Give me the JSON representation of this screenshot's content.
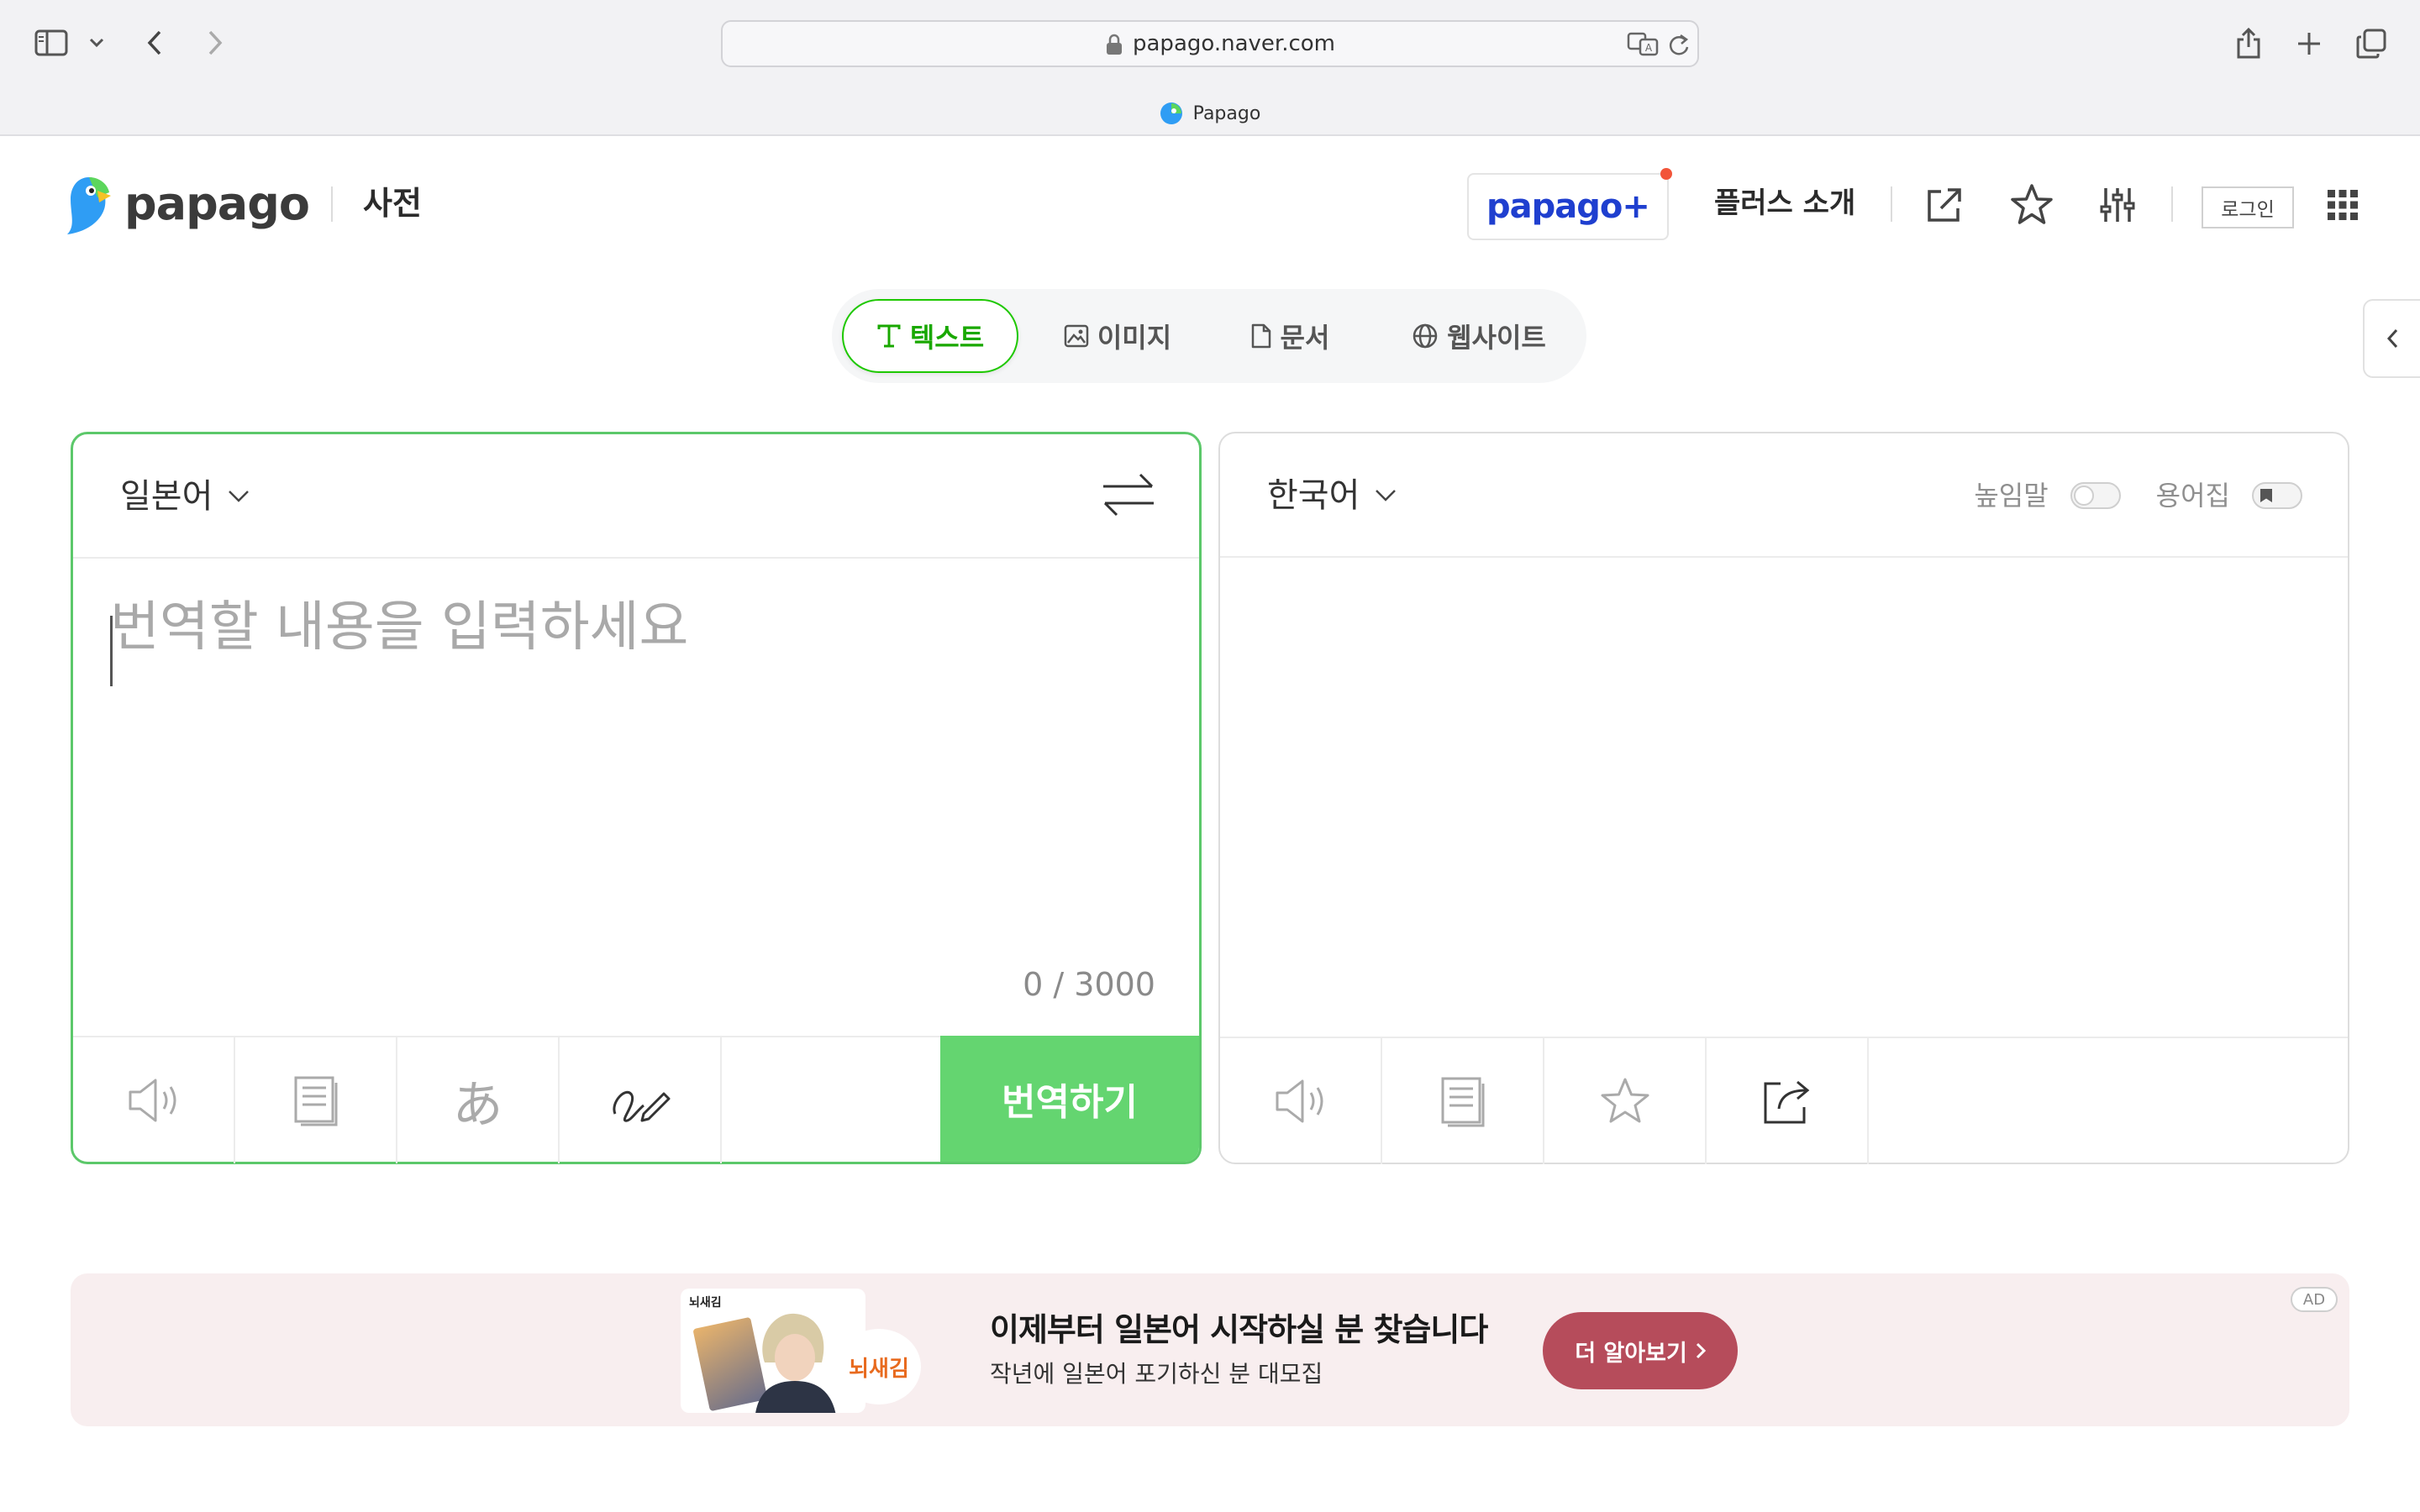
{
  "browser": {
    "url": "papago.naver.com",
    "tab_title": "Papago"
  },
  "header": {
    "logo_text": "papago",
    "dict_label": "사전",
    "plus_label": "papago+",
    "plus_intro_label": "플러스 소개",
    "login_label": "로그인"
  },
  "modes": {
    "items": [
      {
        "label": "텍스트",
        "icon": "text-icon",
        "active": true
      },
      {
        "label": "이미지",
        "icon": "image-icon",
        "active": false
      },
      {
        "label": "문서",
        "icon": "document-icon",
        "active": false
      },
      {
        "label": "웹사이트",
        "icon": "globe-icon",
        "active": false
      }
    ]
  },
  "source": {
    "language": "일본어",
    "placeholder": "번역할 내용을 입력하세요",
    "value": "",
    "counter": "0 / 3000",
    "tools": [
      "speaker-icon",
      "copy-icon",
      "hiragana-icon",
      "handwriting-icon"
    ],
    "translate_label": "번역하기"
  },
  "target": {
    "language": "한국어",
    "honorific_label": "높임말",
    "glossary_label": "용어집",
    "tools": [
      "speaker-icon",
      "copy-icon",
      "star-icon",
      "share-icon"
    ]
  },
  "ad": {
    "brand_small": "뇌새김",
    "badge_text": "뇌새김",
    "title": "이제부터 일본어 시작하실 분 찾습니다",
    "subtitle": "작년에 일본어 포기하신 분 대모집",
    "cta_label": "더 알아보기",
    "tag": "AD"
  },
  "colors": {
    "accent_green": "#1ec800",
    "translate_button": "#64d570",
    "plus_blue": "#1f3fcf",
    "ad_cta": "#b64c5b",
    "ad_bg": "#f8eeef"
  }
}
